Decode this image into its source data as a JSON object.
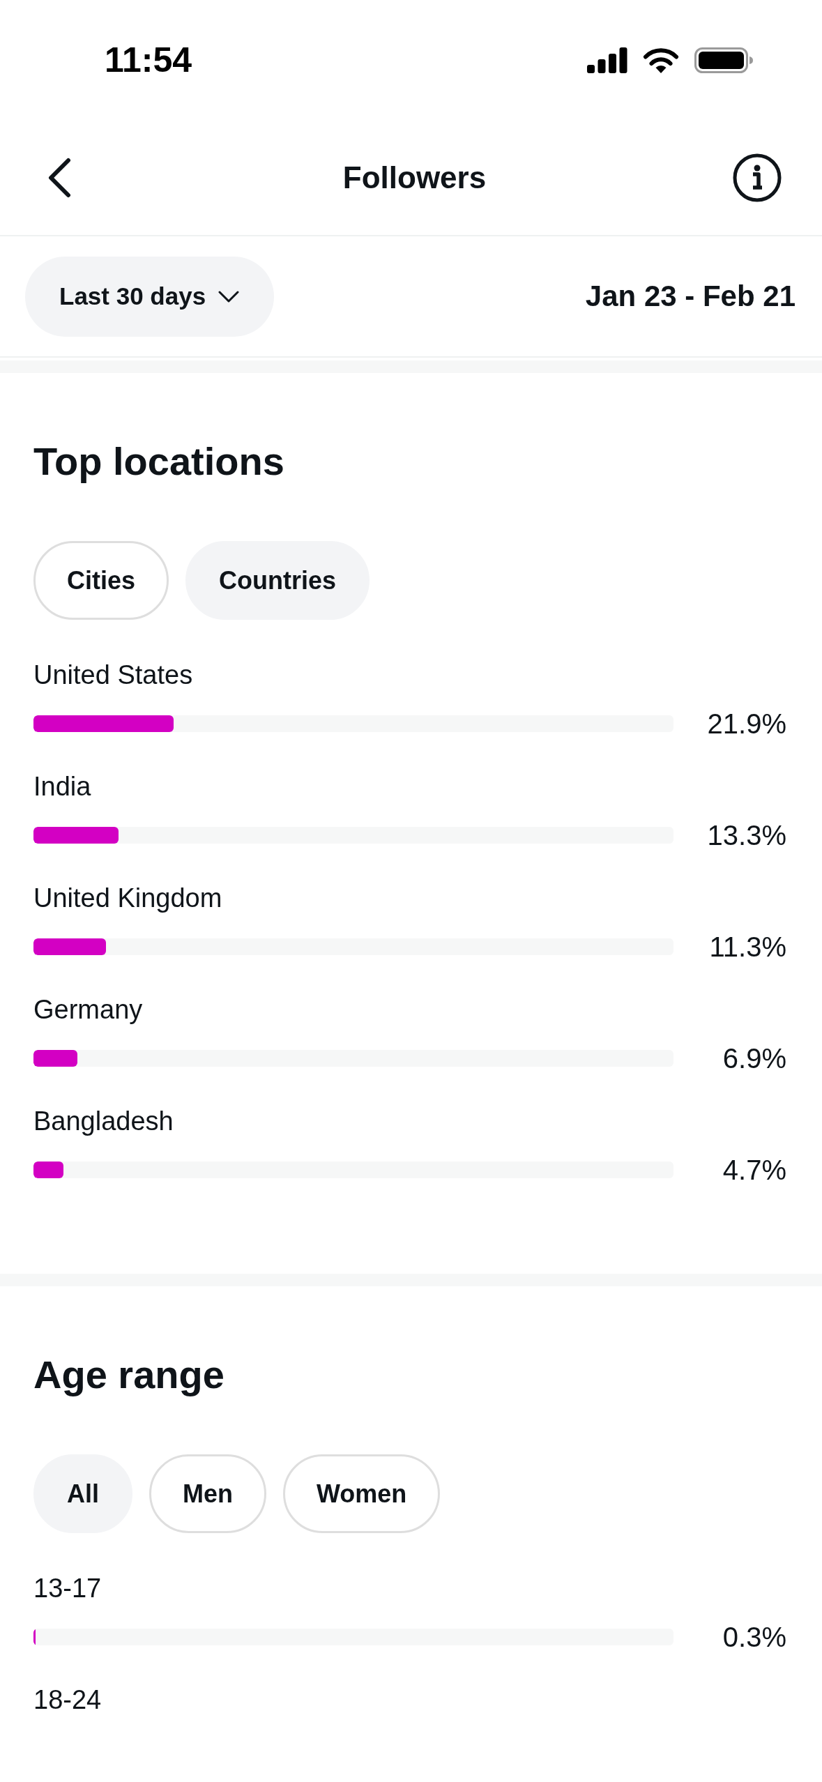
{
  "status_bar": {
    "time": "11:54"
  },
  "header": {
    "title": "Followers"
  },
  "filter": {
    "period": "Last 30 days",
    "date_range": "Jan 23 - Feb 21"
  },
  "sections": [
    {
      "title": "Top locations",
      "chips": [
        {
          "label": "Cities",
          "selected": false
        },
        {
          "label": "Countries",
          "selected": true
        }
      ],
      "rows": [
        {
          "label": "United States",
          "level": 0.219,
          "reading": "21.9%"
        },
        {
          "label": "India",
          "level": 0.133,
          "reading": "13.3%"
        },
        {
          "label": "United Kingdom",
          "level": 0.113,
          "reading": "11.3%"
        },
        {
          "label": "Germany",
          "level": 0.069,
          "reading": "6.9%"
        },
        {
          "label": "Bangladesh",
          "level": 0.047,
          "reading": "4.7%"
        }
      ]
    },
    {
      "title": "Age range",
      "chips": [
        {
          "label": "All",
          "selected": true
        },
        {
          "label": "Men",
          "selected": false
        },
        {
          "label": "Women",
          "selected": false
        }
      ],
      "rows": [
        {
          "label": "13-17",
          "level": 0.003,
          "reading": "0.3%"
        },
        {
          "label": "18-24"
        }
      ]
    }
  ]
}
